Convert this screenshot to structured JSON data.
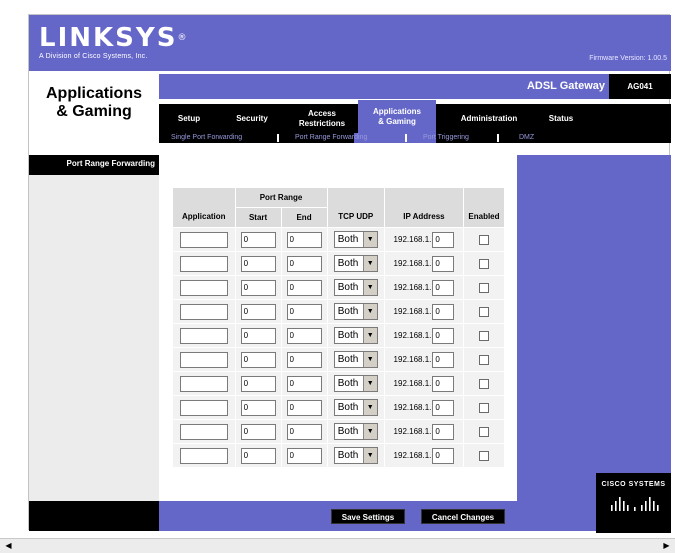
{
  "brand": {
    "name": "LINKSYS",
    "reg": "®",
    "tagline": "A Division of Cisco Systems, Inc."
  },
  "firmware": "Firmware Version: 1.00.5",
  "section_title": "Applications\n& Gaming",
  "gateway": {
    "label": "ADSL Gateway",
    "model": "AG041"
  },
  "tabs": [
    {
      "label": "Setup"
    },
    {
      "label": "Security"
    },
    {
      "label": "Access\nRestrictions"
    },
    {
      "label": "Applications\n& Gaming"
    },
    {
      "label": "Administration"
    },
    {
      "label": "Status"
    }
  ],
  "subnav": [
    {
      "label": "Single Port Forwarding"
    },
    {
      "label": "Port Range Forwarding"
    },
    {
      "label": "Port Triggering"
    },
    {
      "label": "DMZ"
    }
  ],
  "side_label": "Port Range Forwarding",
  "table": {
    "group_header": "Port Range",
    "headers": {
      "application": "Application",
      "start": "Start",
      "end": "End",
      "protocol": "TCP UDP",
      "ip": "IP Address",
      "enabled": "Enabled"
    },
    "rows": [
      {
        "application": "",
        "start": "0",
        "end": "0",
        "protocol": "Both",
        "ip_prefix": "192.168.1.",
        "ip_last": "0"
      },
      {
        "application": "",
        "start": "0",
        "end": "0",
        "protocol": "Both",
        "ip_prefix": "192.168.1.",
        "ip_last": "0"
      },
      {
        "application": "",
        "start": "0",
        "end": "0",
        "protocol": "Both",
        "ip_prefix": "192.168.1.",
        "ip_last": "0"
      },
      {
        "application": "",
        "start": "0",
        "end": "0",
        "protocol": "Both",
        "ip_prefix": "192.168.1.",
        "ip_last": "0"
      },
      {
        "application": "",
        "start": "0",
        "end": "0",
        "protocol": "Both",
        "ip_prefix": "192.168.1.",
        "ip_last": "0"
      },
      {
        "application": "",
        "start": "0",
        "end": "0",
        "protocol": "Both",
        "ip_prefix": "192.168.1.",
        "ip_last": "0"
      },
      {
        "application": "",
        "start": "0",
        "end": "0",
        "protocol": "Both",
        "ip_prefix": "192.168.1.",
        "ip_last": "0"
      },
      {
        "application": "",
        "start": "0",
        "end": "0",
        "protocol": "Both",
        "ip_prefix": "192.168.1.",
        "ip_last": "0"
      },
      {
        "application": "",
        "start": "0",
        "end": "0",
        "protocol": "Both",
        "ip_prefix": "192.168.1.",
        "ip_last": "0"
      },
      {
        "application": "",
        "start": "0",
        "end": "0",
        "protocol": "Both",
        "ip_prefix": "192.168.1.",
        "ip_last": "0"
      }
    ]
  },
  "buttons": {
    "save": "Save Settings",
    "cancel": "Cancel Changes"
  },
  "cisco_logo": "CISCO SYSTEMS",
  "icons": {
    "dropdown": "chevron-down-icon",
    "scroll_left": "arrow-left-icon",
    "scroll_right": "arrow-right-icon"
  },
  "colors": {
    "purple": "#6567c8",
    "black": "#000000",
    "gray": "#ececec"
  }
}
